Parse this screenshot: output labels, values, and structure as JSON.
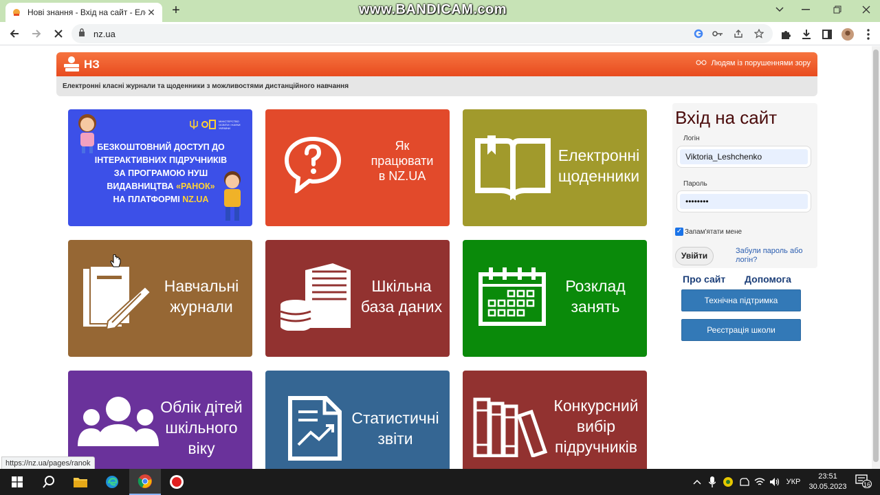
{
  "browser": {
    "tab_title": "Нові знання - Вхід на сайт - Еле",
    "new_tab": "+",
    "watermark": "www.BANDICAM.com",
    "url": "nz.ua",
    "status_url": "https://nz.ua/pages/ranok"
  },
  "site": {
    "logo_text": "НЗ",
    "vision_link": "Людям із порушеннями зору",
    "tagline": "Електронні класні журнали та щоденники з можливостями дистанційного навчання"
  },
  "promo": {
    "lines": [
      "БЕЗКОШТОВНИЙ ДОСТУП ДО",
      "ІНТЕРАКТИВНИХ ПІДРУЧНИКІВ",
      "ЗА ПРОГРАМОЮ НУШ"
    ],
    "line4_prefix": "ВИДАВНИЦТВА ",
    "line4_highlight": "«РАНОК»",
    "line5_prefix": "НА ПЛАТФОРМІ ",
    "line5_highlight": "NZ.UA",
    "ministry_text": "МІНІСТЕРСТВО ОСВІТИ І НАУКИ УКРАЇНИ"
  },
  "tiles": [
    {
      "lines": [
        "Як",
        "працювати",
        "в NZ.UA"
      ],
      "color": "#e24a2b"
    },
    {
      "lines": [
        "Електронні",
        "щоденники"
      ],
      "color": "#a19a2c"
    },
    {
      "lines": [
        "Навчальні",
        "журнали"
      ],
      "color": "#966734"
    },
    {
      "lines": [
        "Шкільна",
        "база даних"
      ],
      "color": "#923230"
    },
    {
      "lines": [
        "Розклад",
        "занять"
      ],
      "color": "#0a8a0a"
    },
    {
      "lines": [
        "Облік дітей",
        "шкільного",
        "віку"
      ],
      "color": "#6a329b"
    },
    {
      "lines": [
        "Статистичні",
        "звіти"
      ],
      "color": "#356693"
    },
    {
      "lines": [
        "Конкурсний",
        "вибір",
        "підручників"
      ],
      "color": "#923230"
    }
  ],
  "login": {
    "title": "Вхід на сайт",
    "login_label": "Логін",
    "login_value": "Viktoria_Leshchenko",
    "password_label": "Пароль",
    "password_value": "••••••••",
    "remember": "Запам'ятати мене",
    "submit": "Увійти",
    "forgot": "Забули пароль або логін?"
  },
  "links": {
    "about": "Про сайт",
    "help": "Допомога",
    "support": "Технічна підтримка",
    "register": "Реєстрація школи"
  },
  "taskbar": {
    "language": "УКР",
    "time": "23:51",
    "date": "30.05.2023",
    "notifications": "16"
  }
}
